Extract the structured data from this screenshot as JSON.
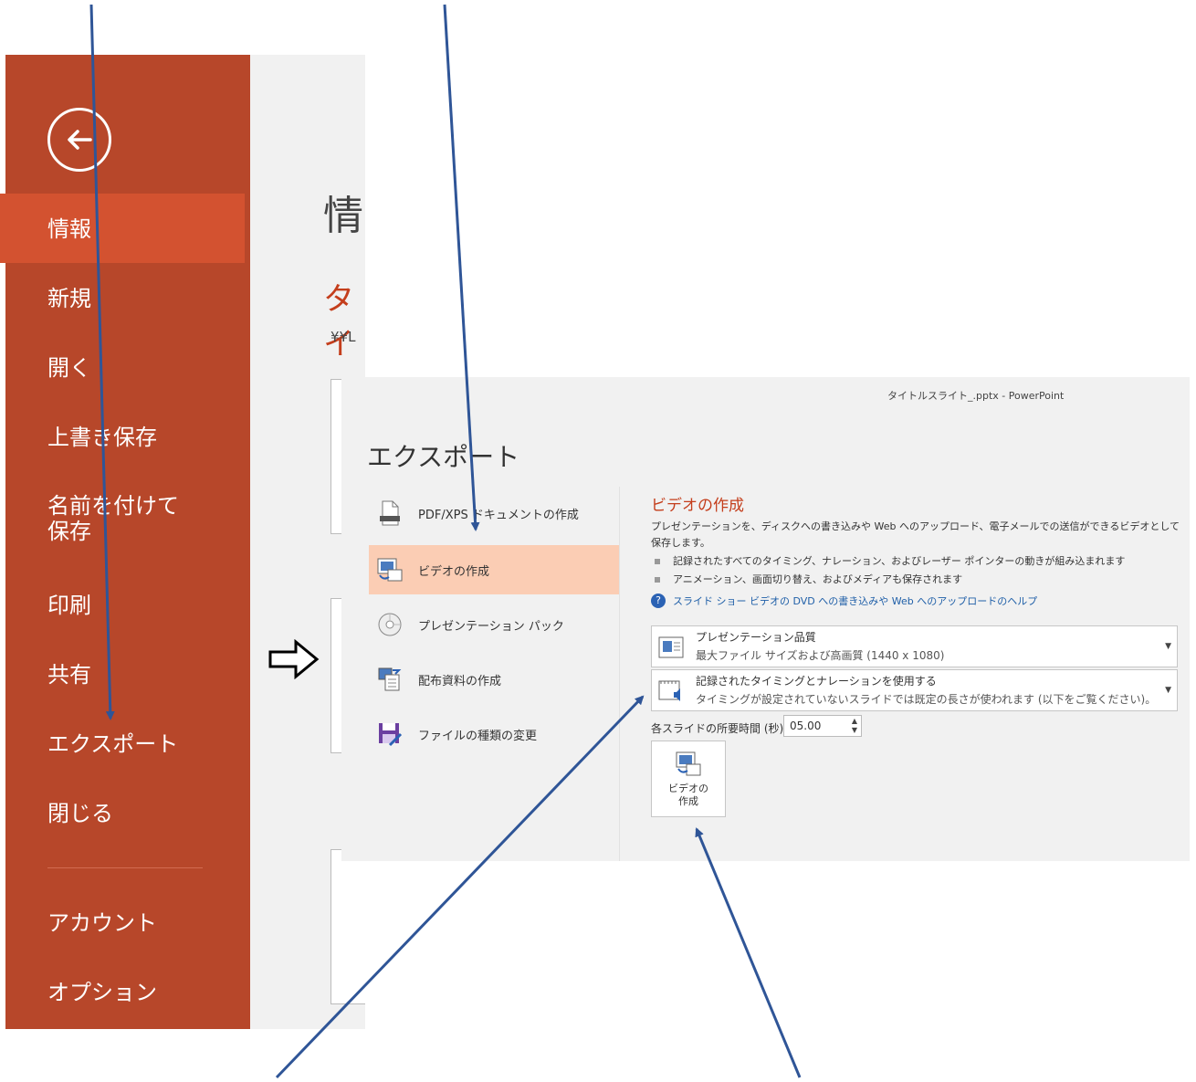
{
  "backstage": {
    "menu": [
      {
        "label": "情報",
        "active": true
      },
      {
        "label": "新規"
      },
      {
        "label": "開く"
      },
      {
        "label": "上書き保存"
      },
      {
        "label": "名前を付けて 保存"
      },
      {
        "label": "印刷"
      },
      {
        "label": "共有"
      },
      {
        "label": "エクスポート"
      },
      {
        "label": "閉じる"
      },
      {
        "label": "アカウント"
      },
      {
        "label": "オプション"
      }
    ],
    "info_title": "情",
    "file_title": "タイ",
    "path": "¥¥L",
    "accent": "#b7472a",
    "active_color": "#d35230"
  },
  "export": {
    "window_title": "タイトルスライト_.pptx - PowerPoint",
    "heading": "エクスポート",
    "options": [
      {
        "label": "PDF/XPS ドキュメントの作成",
        "icon": "pdf-document-icon"
      },
      {
        "label": "ビデオの作成",
        "icon": "video-icon",
        "active": true
      },
      {
        "label": "プレゼンテーション パック",
        "icon": "cd-package-icon"
      },
      {
        "label": "配布資料の作成",
        "icon": "handout-icon"
      },
      {
        "label": "ファイルの種類の変更",
        "icon": "save-as-type-icon"
      }
    ],
    "right": {
      "title": "ビデオの作成",
      "description": "プレゼンテーションを、ディスクへの書き込みや Web へのアップロード、電子メールでの送信ができるビデオとして保存します。",
      "bullets": [
        "記録されたすべてのタイミング、ナレーション、およびレーザー ポインターの動きが組み込まれます",
        "アニメーション、画面切り替え、およびメディアも保存されます"
      ],
      "help_link": "スライド ショー ビデオの DVD への書き込みや Web へのアップロードのヘルプ",
      "quality": {
        "line1": "プレゼンテーション品質",
        "line2": "最大ファイル サイズおよび高画質 (1440 x 1080)"
      },
      "timing": {
        "line1": "記録されたタイミングとナレーションを使用する",
        "line2": "タイミングが設定されていないスライドでは既定の長さが使われます (以下をご覧ください)。このオプ…"
      },
      "duration_label": "各スライドの所要時間 (秒):",
      "duration_value": "05.00",
      "create_button": "ビデオの 作成"
    }
  }
}
